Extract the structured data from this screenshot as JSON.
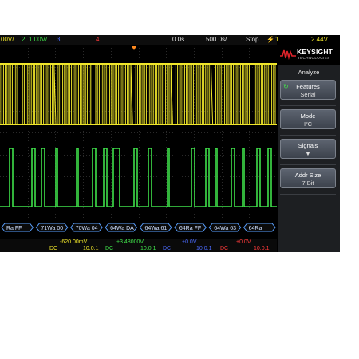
{
  "topbar": {
    "ch1_scale": "00V/",
    "ch2_num": "2",
    "ch2_scale": "1.00V/",
    "ch3_num": "3",
    "ch4_num": "4",
    "delay": "0.0s",
    "timebase": "500.0s/",
    "run_state": "Stop",
    "trigger_icon": "trigger-edge",
    "trigger_ch": "1",
    "trigger_level": "2.44V"
  },
  "decode": {
    "labels": [
      "Ra  FF",
      "71Wa  00",
      "70Wa  04",
      "64Wa  DA",
      "64Wa  61",
      "64Ra  FF",
      "64Wa  63",
      "64Ra"
    ]
  },
  "readout": {
    "ch1_offset": "-620.00mV",
    "ch2_offset": "+3.48000V",
    "ch3_offset": "+0.0V",
    "ch4_offset": "+0.0V",
    "coupling_1": "DC",
    "probe_1": "10.0:1",
    "coupling_2": "DC",
    "probe_2": "10.0:1",
    "coupling_3": "DC",
    "probe_3": "10.0:1",
    "coupling_4": "DC",
    "probe_4": "10.0:1"
  },
  "panel": {
    "brand": "KEYSIGHT",
    "brand_sub": "TECHNOLOGIES",
    "menu_title": "Analyze",
    "softkeys": [
      {
        "label": "Features",
        "value": "Serial",
        "icon": "refresh-icon"
      },
      {
        "label": "Mode",
        "value": "I²C"
      },
      {
        "label": "Signals",
        "value": "▼"
      },
      {
        "label": "Addr Size",
        "value": "7 Bit"
      }
    ]
  },
  "colors": {
    "ch1": "#f0e62a",
    "ch2": "#3fe04a",
    "ch3": "#4b6bff",
    "ch4": "#ff3b3b",
    "decode": "#5aa0ff"
  }
}
